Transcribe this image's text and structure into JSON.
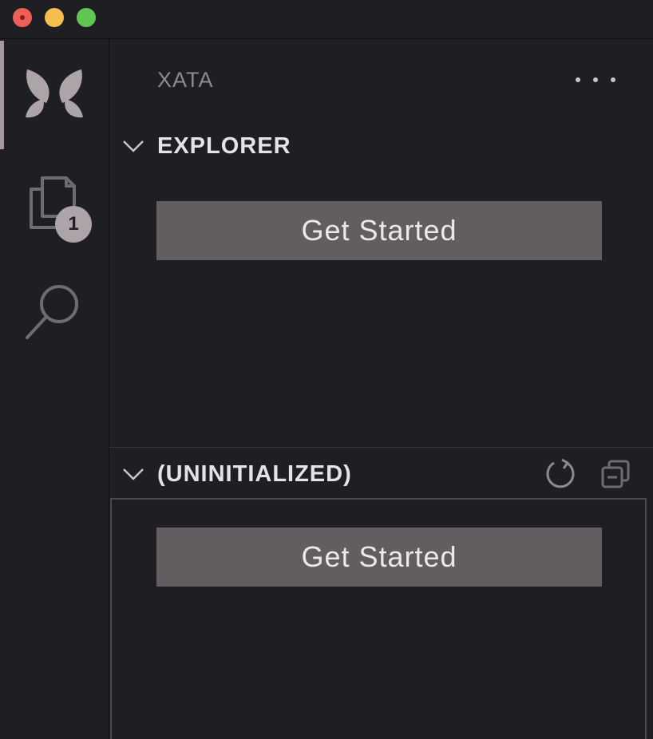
{
  "window": {
    "controls": [
      "close",
      "minimize",
      "maximize"
    ]
  },
  "activity_bar": {
    "items": [
      {
        "icon": "xata-butterfly-icon",
        "active": true
      },
      {
        "icon": "files-icon",
        "badge": "1"
      },
      {
        "icon": "search-icon"
      }
    ]
  },
  "sidebar": {
    "title": "XATA",
    "more_icon": "ellipsis-icon",
    "sections": [
      {
        "label": "EXPLORER",
        "button_label": "Get Started"
      },
      {
        "label": "(UNINITIALIZED)",
        "button_label": "Get Started",
        "actions": [
          "refresh-icon",
          "collapse-all-icon"
        ]
      }
    ]
  },
  "colors": {
    "background": "#1f1e23",
    "button_bg": "#625d61",
    "accent": "#ada4aa",
    "close": "#ed5f57",
    "minimize": "#f5bf4f",
    "maximize": "#61c554"
  }
}
